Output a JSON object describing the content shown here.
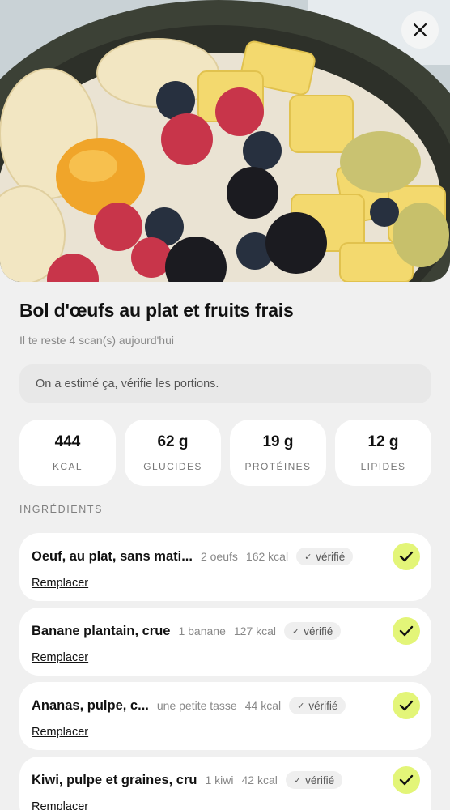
{
  "header": {
    "close_icon": "close-icon"
  },
  "meal": {
    "title": "Bol d'œufs au plat et fruits frais",
    "scans_left": "Il te reste 4 scan(s) aujourd'hui",
    "notice": "On a estimé ça, vérifie les portions."
  },
  "stats": [
    {
      "value": "444",
      "label": "KCAL"
    },
    {
      "value": "62 g",
      "label": "GLUCIDES"
    },
    {
      "value": "19 g",
      "label": "PROTÉINES"
    },
    {
      "value": "12 g",
      "label": "LIPIDES"
    }
  ],
  "ingredients_label": "INGRÉDIENTS",
  "ingredients": [
    {
      "name": "Oeuf, au plat, sans mati...",
      "qty": "2 oeufs",
      "kcal": "162 kcal",
      "badge": "vérifié",
      "replace": "Remplacer"
    },
    {
      "name": "Banane plantain, crue",
      "qty": "1 banane",
      "kcal": "127 kcal",
      "badge": "vérifié",
      "replace": "Remplacer"
    },
    {
      "name": "Ananas, pulpe, c...",
      "qty": "une petite tasse",
      "kcal": "44 kcal",
      "badge": "vérifié",
      "replace": "Remplacer"
    },
    {
      "name": "Kiwi, pulpe et graines, cru",
      "qty": "1 kiwi",
      "kcal": "42 kcal",
      "badge": "vérifié",
      "replace": "Remplacer"
    }
  ],
  "colors": {
    "accent": "#e3f578",
    "background": "#f0f0f0",
    "card": "#ffffff"
  }
}
